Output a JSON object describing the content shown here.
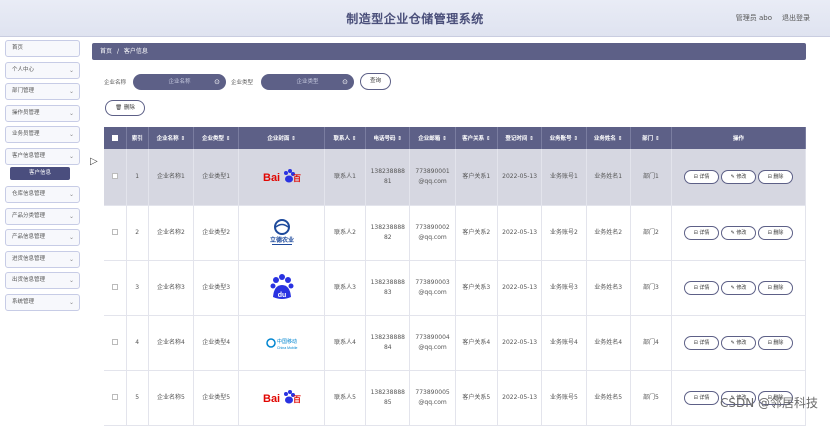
{
  "header": {
    "title": "制造型企业仓储管理系统",
    "admin": "管理员 abo",
    "logout": "退出登录"
  },
  "sidebar": {
    "items": [
      {
        "label": "首页",
        "has_chevron": false
      },
      {
        "label": "个人中心",
        "has_chevron": true
      },
      {
        "label": "部门管理",
        "has_chevron": true
      },
      {
        "label": "操作员管理",
        "has_chevron": true
      },
      {
        "label": "业务员管理",
        "has_chevron": true
      },
      {
        "label": "客户信息管理",
        "has_chevron": true
      },
      {
        "label": "仓库信息管理",
        "has_chevron": true
      },
      {
        "label": "产品分类管理",
        "has_chevron": true
      },
      {
        "label": "产品信息管理",
        "has_chevron": true
      },
      {
        "label": "进货信息管理",
        "has_chevron": true
      },
      {
        "label": "出货信息管理",
        "has_chevron": true
      },
      {
        "label": "系统管理",
        "has_chevron": true
      }
    ],
    "active_sub": "客户信息"
  },
  "breadcrumb": {
    "home": "首页",
    "sep": "/",
    "current": "客户信息"
  },
  "search": {
    "name_label": "企业名称",
    "name_placeholder": "企业名称",
    "type_label": "企业类型",
    "type_placeholder": "企业类型",
    "query_label": "查询"
  },
  "delete_label": "删除",
  "table": {
    "headers": [
      "",
      "索引",
      "企业名称 ⇕",
      "企业类型 ⇕",
      "企业封面 ⇕",
      "联系人 ⇕",
      "电话号码 ⇕",
      "企业邮箱 ⇕",
      "客户关系 ⇕",
      "登记时间 ⇕",
      "业务账号 ⇕",
      "业务姓名 ⇕",
      "部门 ⇕",
      "操作"
    ],
    "rows": [
      {
        "index": "1",
        "name": "企业名称1",
        "type": "企业类型1",
        "logo": "baidu",
        "contact": "联系人1",
        "phone_a": "138238888",
        "phone_b": "81",
        "email_a": "773890001",
        "email_b": "@qq.com",
        "relation": "客户关系1",
        "date": "2022-05-13",
        "account": "业务账号1",
        "staff": "业务姓名1",
        "dept": "部门1"
      },
      {
        "index": "2",
        "name": "企业名称2",
        "type": "企业类型2",
        "logo": "liwei",
        "contact": "联系人2",
        "phone_a": "138238888",
        "phone_b": "82",
        "email_a": "773890002",
        "email_b": "@qq.com",
        "relation": "客户关系2",
        "date": "2022-05-13",
        "account": "业务账号2",
        "staff": "业务姓名2",
        "dept": "部门2"
      },
      {
        "index": "3",
        "name": "企业名称3",
        "type": "企业类型3",
        "logo": "du",
        "contact": "联系人3",
        "phone_a": "138238888",
        "phone_b": "83",
        "email_a": "773890003",
        "email_b": "@qq.com",
        "relation": "客户关系3",
        "date": "2022-05-13",
        "account": "业务账号3",
        "staff": "业务姓名3",
        "dept": "部门3"
      },
      {
        "index": "4",
        "name": "企业名称4",
        "type": "企业类型4",
        "logo": "mobile",
        "contact": "联系人4",
        "phone_a": "138238888",
        "phone_b": "84",
        "email_a": "773890004",
        "email_b": "@qq.com",
        "relation": "客户关系4",
        "date": "2022-05-13",
        "account": "业务账号4",
        "staff": "业务姓名4",
        "dept": "部门4"
      },
      {
        "index": "5",
        "name": "企业名称5",
        "type": "企业类型5",
        "logo": "baidu",
        "contact": "联系人5",
        "phone_a": "138238888",
        "phone_b": "85",
        "email_a": "773890005",
        "email_b": "@qq.com",
        "relation": "客户关系5",
        "date": "2022-05-13",
        "account": "业务账号5",
        "staff": "业务姓名5",
        "dept": "部门5"
      }
    ],
    "actions": [
      "详情",
      "修改",
      "删除"
    ]
  },
  "logos": {
    "baidu": {
      "text_a": "Bai",
      "text_b": "百度"
    },
    "liwei": {
      "text": "立德农业"
    },
    "mobile": {
      "text": "中国移动"
    }
  },
  "watermark": "CSDN @邻居科技",
  "colors": {
    "primary": "#5d6087",
    "header_bg": "#e3e6f2",
    "highlight_row": "#d6d7e1"
  }
}
